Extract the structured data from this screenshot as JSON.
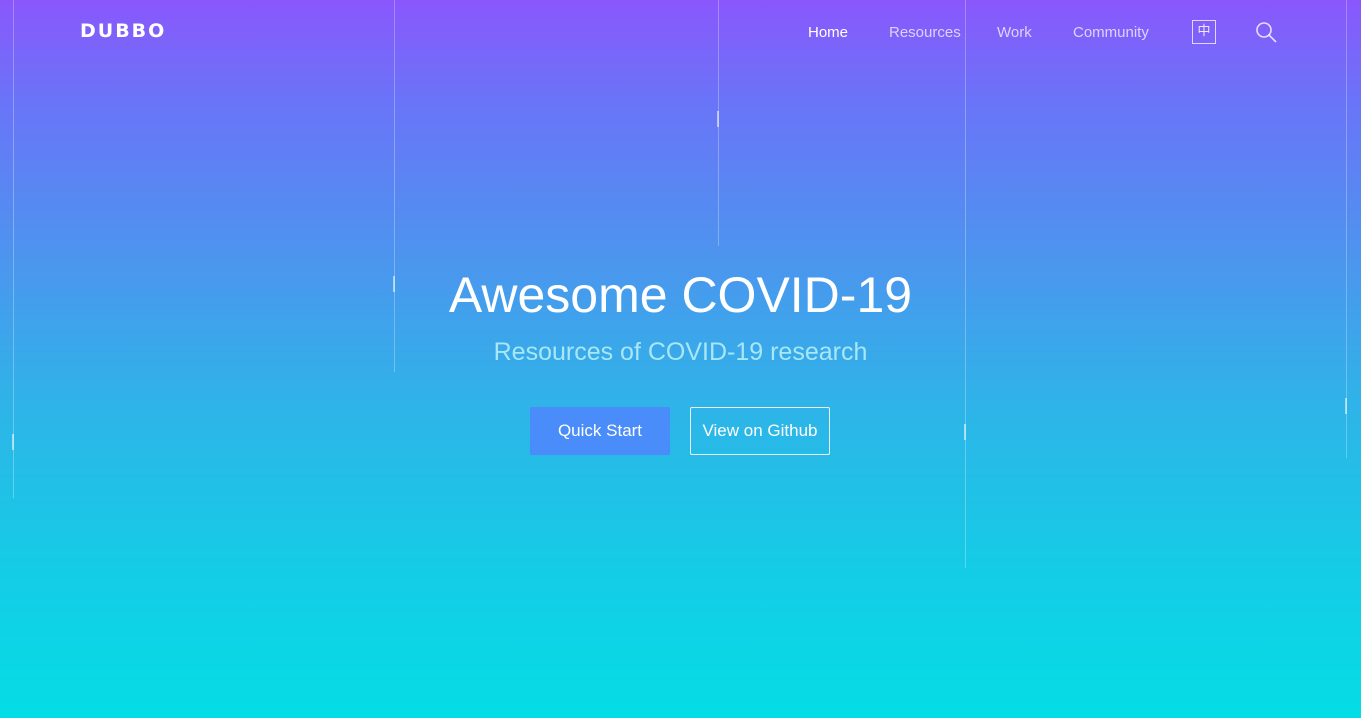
{
  "header": {
    "logo_text": "DUBBO",
    "nav": [
      {
        "label": "Home",
        "active": true
      },
      {
        "label": "Resources",
        "active": false
      },
      {
        "label": "Work",
        "active": false
      },
      {
        "label": "Community",
        "active": false
      }
    ],
    "language_toggle": "中",
    "search_icon": "search-icon"
  },
  "hero": {
    "title": "Awesome COVID-19",
    "subtitle": "Resources of COVID-19 research",
    "primary_button": "Quick Start",
    "secondary_button": "View on Github"
  },
  "colors": {
    "gradient_top": "#8a57fc",
    "gradient_bottom": "#04dde5",
    "primary_button": "#4a8cf9",
    "subtitle": "#a7e7f6"
  }
}
